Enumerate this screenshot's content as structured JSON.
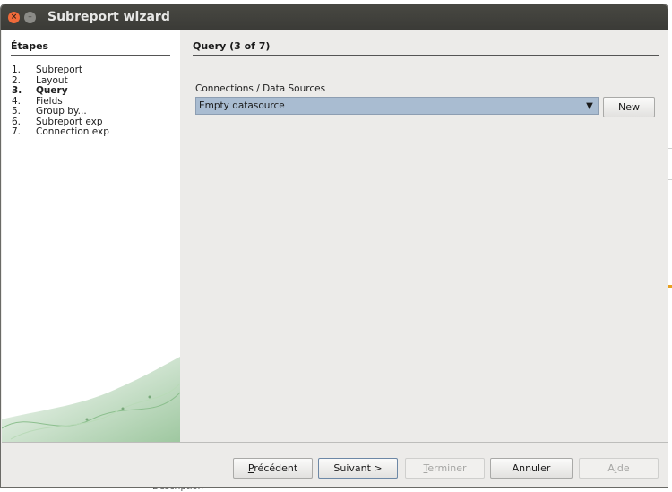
{
  "window": {
    "title": "Subreport wizard"
  },
  "sidebar": {
    "title": "Étapes",
    "items": [
      {
        "number": "1.",
        "label": "Subreport",
        "current": false
      },
      {
        "number": "2.",
        "label": "Layout",
        "current": false
      },
      {
        "number": "3.",
        "label": "Query",
        "current": true
      },
      {
        "number": "4.",
        "label": "Fields",
        "current": false
      },
      {
        "number": "5.",
        "label": "Group by...",
        "current": false
      },
      {
        "number": "6.",
        "label": "Subreport exp",
        "current": false
      },
      {
        "number": "7.",
        "label": "Connection exp",
        "current": false
      }
    ]
  },
  "main": {
    "title": "Query (3 of 7)",
    "connection_label": "Connections / Data Sources",
    "connection_value": "Empty datasource",
    "new_button": "New"
  },
  "footer": {
    "previous": "Précédent",
    "next": "Suivant >",
    "finish": "Terminer",
    "cancel": "Annuler",
    "help": "Ajde"
  },
  "background": {
    "text": "Description"
  },
  "colors": {
    "titlebar": "#3b3b37",
    "close": "#ef6a3a",
    "combo": "#a9bcd1",
    "panel": "#ecebe9"
  }
}
